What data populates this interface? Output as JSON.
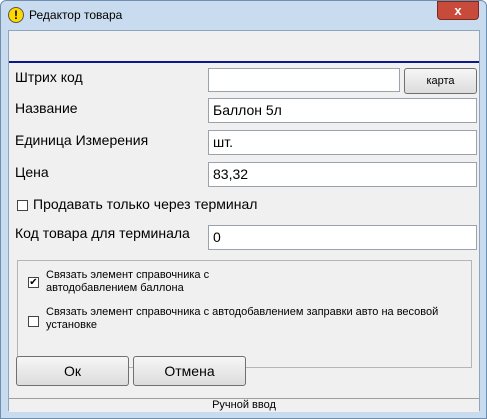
{
  "window": {
    "title": "Редактор товара",
    "close_label": "x"
  },
  "form": {
    "barcode_label": "Штрих код",
    "barcode_value": "",
    "card_button": "карта",
    "name_label": "Название",
    "name_value": "Баллон 5л",
    "unit_label": "Единица Измерения",
    "unit_value": "шт.",
    "price_label": "Цена",
    "price_value": "83,32",
    "terminal_only_label": "Продавать только через терминал",
    "terminal_code_label": "Код товара для терминала",
    "terminal_code_value": "0"
  },
  "group": {
    "link_balloon_line1": "Связать элемент справочника с",
    "link_balloon_line2": "автодобавлением баллона",
    "link_balloon_checked": true,
    "link_scale_line1": "Связать элемент справочника с автодобавлением заправки авто на весовой",
    "link_scale_line2": "установке",
    "link_scale_checked": false
  },
  "buttons": {
    "ok": "Ок",
    "cancel": "Отмена"
  },
  "status": {
    "text": "Ручной ввод"
  }
}
